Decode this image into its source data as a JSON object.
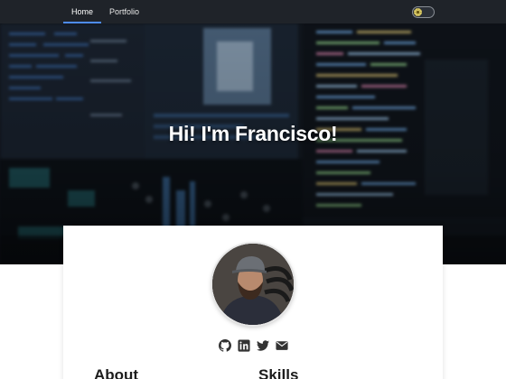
{
  "navbar": {
    "items": [
      {
        "label": "Home",
        "active": true
      },
      {
        "label": "Portfolio",
        "active": false
      }
    ],
    "theme_toggle": {
      "icon": "sun-icon",
      "state": "light"
    }
  },
  "hero": {
    "title": "Hi! I'm Francisco!"
  },
  "profile": {
    "socials": [
      {
        "icon": "github-icon"
      },
      {
        "icon": "linkedin-icon"
      },
      {
        "icon": "twitter-icon"
      },
      {
        "icon": "email-icon"
      }
    ]
  },
  "sections": {
    "about": "About",
    "skills": "Skills"
  },
  "colors": {
    "navbar_bg": "#1f2329",
    "active_underline": "#4d8cf5",
    "toggle_knob": "#e2d36c",
    "icon_color": "#333333"
  }
}
